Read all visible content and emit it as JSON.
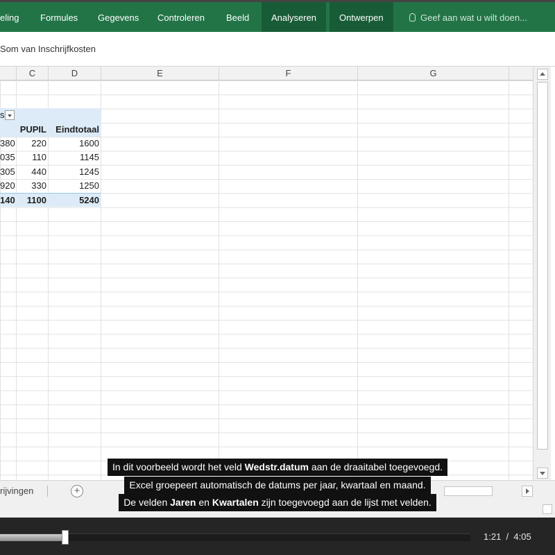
{
  "ribbon": {
    "tabs": [
      {
        "label": "eling",
        "active": false
      },
      {
        "label": "Formules",
        "active": false
      },
      {
        "label": "Gegevens",
        "active": false
      },
      {
        "label": "Controleren",
        "active": false
      },
      {
        "label": "Beeld",
        "active": false
      },
      {
        "label": "Analyseren",
        "active": true
      },
      {
        "label": "Ontwerpen",
        "active": true
      }
    ],
    "tell_me": "Geef aan wat u wilt doen...",
    "accent_color": "#227447",
    "active_tab_color": "#185c37"
  },
  "formula_bar": {
    "text": "Som van Inschrijfkosten"
  },
  "grid": {
    "columns": [
      "C",
      "D",
      "E",
      "F",
      "G"
    ],
    "pivot": {
      "filter_label": "s",
      "headers": [
        "PUPIL",
        "Eindtotaal"
      ],
      "rows": [
        [
          "380",
          "220",
          "1600"
        ],
        [
          "035",
          "110",
          "1145"
        ],
        [
          "305",
          "440",
          "1245"
        ],
        [
          "920",
          "330",
          "1250"
        ]
      ],
      "total": [
        "140",
        "1100",
        "5240"
      ],
      "band_color": "#dcebf7"
    }
  },
  "sheet_tabs": {
    "active_sheet": "rijvingen",
    "add_symbol": "+"
  },
  "subtitles": {
    "line1": {
      "before": "In dit voorbeeld wordt het veld ",
      "bold": "Wedstr.datum",
      "after": " aan de draaitabel toegevoegd."
    },
    "line2": "Excel groepeert automatisch de datums per jaar, kwartaal en maand.",
    "line3": {
      "before": "De velden ",
      "bold1": "Jaren",
      "middle": " en ",
      "bold2": "Kwartalen",
      "after": " zijn toegevoegd aan de lijst met velden."
    }
  },
  "player": {
    "current_time": "1:21",
    "separator": "/",
    "total_time": "4:05",
    "progress": 0.33
  }
}
